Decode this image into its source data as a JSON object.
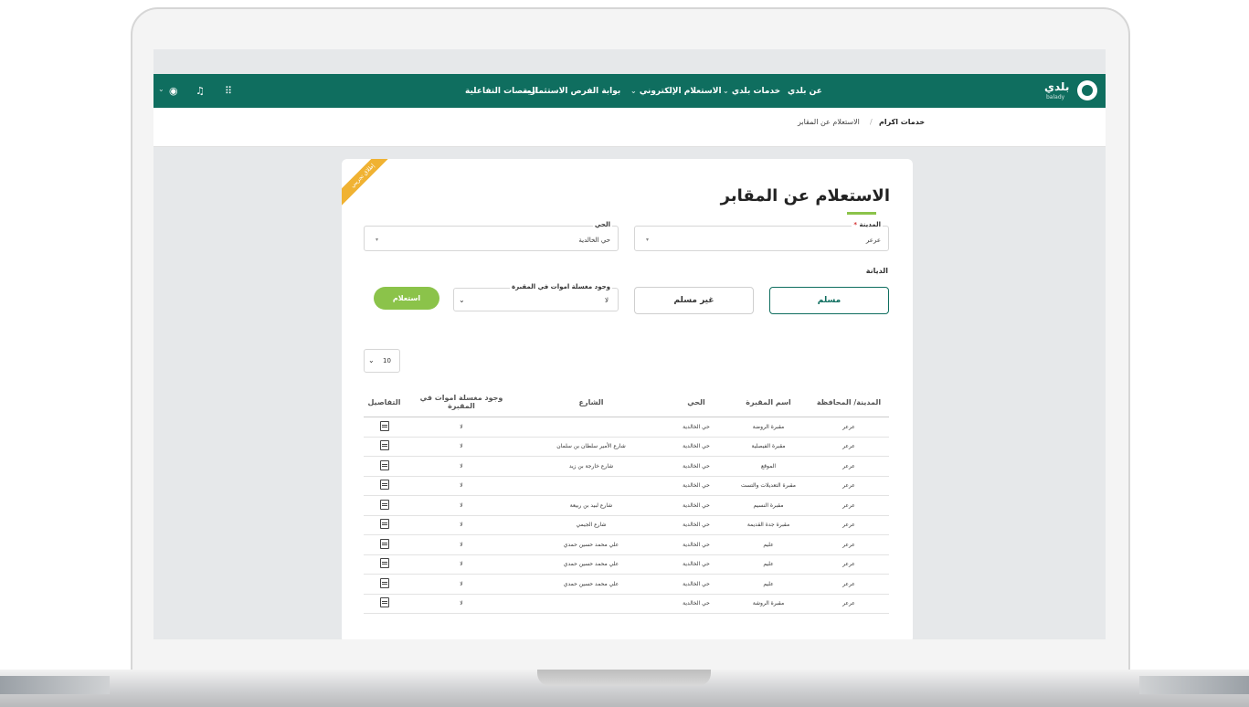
{
  "nav": {
    "logo_text": "بلدي",
    "logo_sub": "balady",
    "items": [
      {
        "label": "عن بلدي",
        "dropdown": false
      },
      {
        "label": "خدمات بلدي",
        "dropdown": true
      },
      {
        "label": "الاستعلام الإلكتروني",
        "dropdown": true
      },
      {
        "label": "بوابة الفرص الاستثمارية",
        "dropdown": false
      },
      {
        "label": "المنصات التفاعلية",
        "dropdown": false
      }
    ],
    "icons": [
      "grid-icon",
      "bell-icon",
      "globe-icon",
      "chevron-down-icon"
    ]
  },
  "breadcrumb": {
    "root": "خدمات اكرام",
    "separator": "/",
    "current": "الاستعلام عن المقابر"
  },
  "form": {
    "ribbon": "إطلاق تجريبي",
    "title": "الاستعلام عن المقابر",
    "city_label": "المدينة",
    "city_required": "*",
    "city_value": "عرعر",
    "district_label": "الحي",
    "district_value": "حي الخالدية",
    "religion_label": "الديانة",
    "religion_muslim": "مسلم",
    "religion_non_muslim": "غير مسلم",
    "washroom_label": "وجود مغسلة اموات في المقبرة",
    "washroom_value": "لا",
    "submit_label": "استعلام"
  },
  "table": {
    "page_size": "10",
    "headers": [
      "المدينة/ المحافظة",
      "اسم المقبرة",
      "الحي",
      "الشارع",
      "وجود مغسلة اموات في المقبرة",
      "التفاصيل"
    ],
    "rows": [
      [
        "عرعر",
        "مقبرة الروضة",
        "حي الخالدية",
        "",
        "لا"
      ],
      [
        "عرعر",
        "مقبرة الفيصلية",
        "حي الخالدية",
        "شارع الأمير سلطان بن سلمان",
        "لا"
      ],
      [
        "عرعر",
        "الموقع",
        "حي الخالدية",
        "شارع خارجة بن زيد",
        "لا"
      ],
      [
        "عرعر",
        "مقبرة التعديلات والتست",
        "حي الخالدية",
        "",
        "لا"
      ],
      [
        "عرعر",
        "مقبرة النسيم",
        "حي الخالدية",
        "شارع لبيد بن ربيعة",
        "لا"
      ],
      [
        "عرعر",
        "مقبرة جدة القديمة",
        "حي الخالدية",
        "شارع الجيمي",
        "لا"
      ],
      [
        "عرعر",
        "عليم",
        "حي الخالدية",
        "علي محمد حسين حمدي",
        "لا"
      ],
      [
        "عرعر",
        "عليم",
        "حي الخالدية",
        "علي محمد حسين حمدي",
        "لا"
      ],
      [
        "عرعر",
        "عليم",
        "حي الخالدية",
        "علي محمد حسين حمدي",
        "لا"
      ],
      [
        "عرعر",
        "مقبرة الروشة",
        "حي الخالدية",
        "",
        "لا"
      ]
    ]
  },
  "colors": {
    "brand": "#0f6e5f",
    "accent": "#8bc34a",
    "ribbon": "#f0b232"
  }
}
